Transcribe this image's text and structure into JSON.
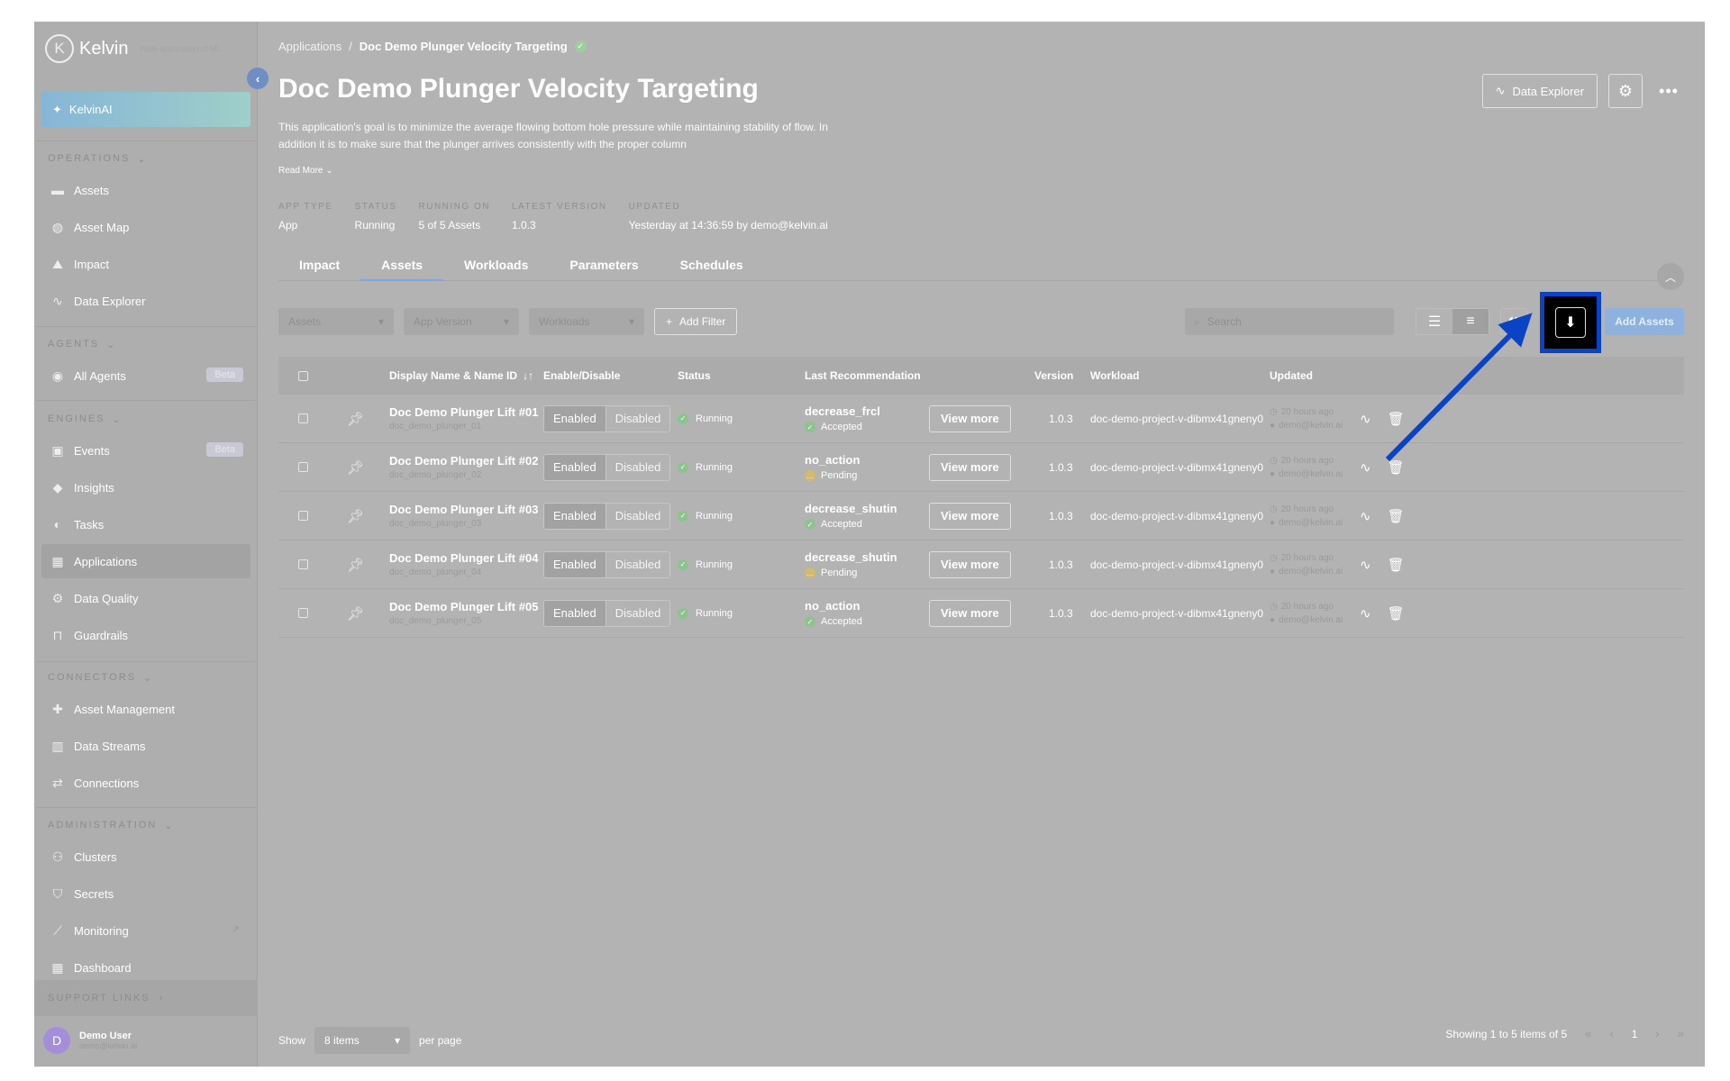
{
  "app": {
    "name": "Kelvin",
    "subtitle": "Wide application of ML"
  },
  "sidebar": {
    "kelvinai": "KelvinAI",
    "sections": [
      {
        "label": "OPERATIONS",
        "items": [
          {
            "label": "Assets",
            "icon": "assets-icon"
          },
          {
            "label": "Asset Map",
            "icon": "globe-icon"
          },
          {
            "label": "Impact",
            "icon": "impact-icon"
          },
          {
            "label": "Data Explorer",
            "icon": "pulse-icon"
          }
        ]
      },
      {
        "label": "AGENTS",
        "items": [
          {
            "label": "All Agents",
            "icon": "agent-icon",
            "badge": "Beta"
          }
        ]
      },
      {
        "label": "ENGINES",
        "items": [
          {
            "label": "Events",
            "icon": "events-icon",
            "badge": "Beta"
          },
          {
            "label": "Insights",
            "icon": "tag-icon"
          },
          {
            "label": "Tasks",
            "icon": "tasks-icon"
          },
          {
            "label": "Applications",
            "icon": "grid-icon"
          },
          {
            "label": "Data Quality",
            "icon": "gear-icon"
          },
          {
            "label": "Guardrails",
            "icon": "guardrail-icon"
          }
        ]
      },
      {
        "label": "CONNECTORS",
        "items": [
          {
            "label": "Asset Management",
            "icon": "puzzle-icon"
          },
          {
            "label": "Data Streams",
            "icon": "bar-chart-icon"
          },
          {
            "label": "Connections",
            "icon": "connection-icon"
          }
        ]
      },
      {
        "label": "ADMINISTRATION",
        "items": [
          {
            "label": "Clusters",
            "icon": "cluster-icon"
          },
          {
            "label": "Secrets",
            "icon": "shield-icon"
          },
          {
            "label": "Monitoring",
            "icon": "monitor-icon"
          },
          {
            "label": "Dashboard",
            "icon": "dashboard-icon"
          }
        ]
      }
    ],
    "support": "SUPPORT LINKS",
    "user": {
      "initial": "D",
      "name": "Demo User",
      "email": "demo@kelvin.ai"
    }
  },
  "breadcrumb": {
    "root": "Applications",
    "current": "Doc Demo Plunger Velocity Targeting"
  },
  "page": {
    "title": "Doc Demo Plunger Velocity Targeting",
    "description": "This application's goal is to minimize the average flowing bottom hole pressure while maintaining stability of flow. In addition it is to make sure that the plunger arrives consistently with the proper column",
    "read_more": "Read More",
    "data_explorer": "Data Explorer"
  },
  "meta": [
    {
      "label": "APP TYPE",
      "value": "App"
    },
    {
      "label": "STATUS",
      "value": "Running"
    },
    {
      "label": "RUNNING ON",
      "value": "5 of 5 Assets"
    },
    {
      "label": "LATEST VERSION",
      "value": "1.0.3"
    },
    {
      "label": "UPDATED",
      "value": "Yesterday at 14:36:59 by demo@kelvin.ai"
    }
  ],
  "tabs": [
    "Impact",
    "Assets",
    "Workloads",
    "Parameters",
    "Schedules"
  ],
  "active_tab": "Assets",
  "filters": {
    "assets": "Assets",
    "app_version": "App Version",
    "workloads": "Workloads",
    "add_filter": "Add Filter",
    "search_placeholder": "Search",
    "add_assets": "Add Assets"
  },
  "table": {
    "headers": {
      "name": "Display Name & Name ID",
      "enable": "Enable/Disable",
      "status": "Status",
      "recommendation": "Last Recommendation",
      "version": "Version",
      "workload": "Workload",
      "updated": "Updated"
    },
    "rows": [
      {
        "name": "Doc Demo Plunger Lift #01",
        "id": "doc_demo_plunger_01",
        "enabled": "Enabled",
        "disabled": "Disabled",
        "status": "Running",
        "rec": "decrease_frcl",
        "rec_status": "Accepted",
        "view_more": "View more",
        "version": "1.0.3",
        "workload": "doc-demo-project-v-dibmx41gneny0",
        "updated_time": "20 hours ago",
        "updated_by": "demo@kelvin.ai"
      },
      {
        "name": "Doc Demo Plunger Lift #02",
        "id": "doc_demo_plunger_02",
        "enabled": "Enabled",
        "disabled": "Disabled",
        "status": "Running",
        "rec": "no_action",
        "rec_status": "Pending",
        "view_more": "View more",
        "version": "1.0.3",
        "workload": "doc-demo-project-v-dibmx41gneny0",
        "updated_time": "20 hours ago",
        "updated_by": "demo@kelvin.ai"
      },
      {
        "name": "Doc Demo Plunger Lift #03",
        "id": "doc_demo_plunger_03",
        "enabled": "Enabled",
        "disabled": "Disabled",
        "status": "Running",
        "rec": "decrease_shutin",
        "rec_status": "Accepted",
        "view_more": "View more",
        "version": "1.0.3",
        "workload": "doc-demo-project-v-dibmx41gneny0",
        "updated_time": "20 hours ago",
        "updated_by": "demo@kelvin.ai"
      },
      {
        "name": "Doc Demo Plunger Lift #04",
        "id": "doc_demo_plunger_04",
        "enabled": "Enabled",
        "disabled": "Disabled",
        "status": "Running",
        "rec": "decrease_shutin",
        "rec_status": "Pending",
        "view_more": "View more",
        "version": "1.0.3",
        "workload": "doc-demo-project-v-dibmx41gneny0",
        "updated_time": "20 hours ago",
        "updated_by": "demo@kelvin.ai"
      },
      {
        "name": "Doc Demo Plunger Lift #05",
        "id": "doc_demo_plunger_05",
        "enabled": "Enabled",
        "disabled": "Disabled",
        "status": "Running",
        "rec": "no_action",
        "rec_status": "Accepted",
        "view_more": "View more",
        "version": "1.0.3",
        "workload": "doc-demo-project-v-dibmx41gneny0",
        "updated_time": "20 hours ago",
        "updated_by": "demo@kelvin.ai"
      }
    ]
  },
  "pager": {
    "show": "Show",
    "per_page_value": "8 items",
    "per_page": "per page",
    "summary": "Showing 1 to 5 items of 5",
    "page": "1"
  },
  "colors": {
    "highlight": "#0b43c5",
    "arrow": "#0b43c5",
    "accent": "#8eb1de"
  }
}
